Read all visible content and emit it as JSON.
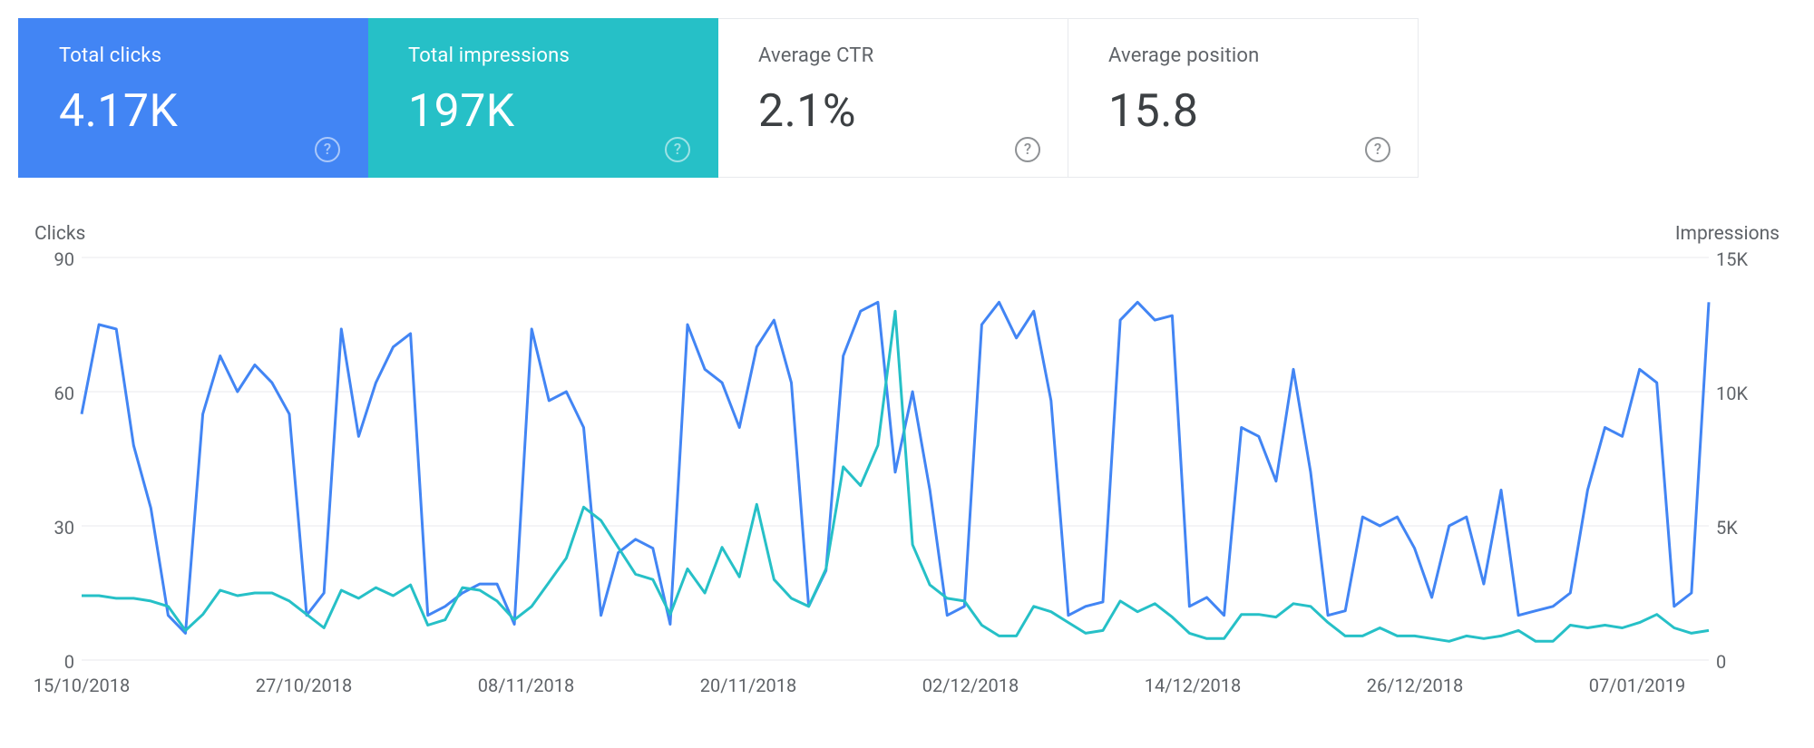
{
  "cards": [
    {
      "key": "clicks",
      "label": "Total clicks",
      "value": "4.17K",
      "active": true,
      "color": "#4285f4"
    },
    {
      "key": "impressions",
      "label": "Total impressions",
      "value": "197K",
      "active": true,
      "color": "#26c0c7"
    },
    {
      "key": "ctr",
      "label": "Average CTR",
      "value": "2.1%",
      "active": false,
      "color": "#ffffff"
    },
    {
      "key": "position",
      "label": "Average position",
      "value": "15.8",
      "active": false,
      "color": "#ffffff"
    }
  ],
  "help_glyph": "?",
  "left_axis_title": "Clicks",
  "right_axis_title": "Impressions",
  "left_ticks": [
    "90",
    "60",
    "30",
    "0"
  ],
  "right_ticks": [
    "15K",
    "10K",
    "5K",
    "0"
  ],
  "x_ticks": [
    "15/10/2018",
    "27/10/2018",
    "08/11/2018",
    "20/11/2018",
    "02/12/2018",
    "14/12/2018",
    "26/12/2018",
    "07/01/2019"
  ],
  "chart_data": {
    "type": "line",
    "title": "",
    "xlabel": "",
    "ylabel_left": "Clicks",
    "ylabel_right": "Impressions",
    "ylim_left": [
      0,
      90
    ],
    "ylim_right": [
      0,
      15000
    ],
    "x_tick_labels": [
      "15/10/2018",
      "27/10/2018",
      "08/11/2018",
      "20/11/2018",
      "02/12/2018",
      "14/12/2018",
      "26/12/2018",
      "07/01/2019"
    ],
    "series": [
      {
        "name": "Clicks",
        "axis": "left",
        "color": "#4285f4",
        "values": [
          55,
          75,
          74,
          48,
          34,
          10,
          6,
          55,
          68,
          60,
          66,
          62,
          55,
          10,
          15,
          74,
          50,
          62,
          70,
          73,
          10,
          12,
          15,
          17,
          17,
          8,
          74,
          58,
          60,
          52,
          10,
          24,
          27,
          25,
          8,
          75,
          65,
          62,
          52,
          70,
          76,
          62,
          12,
          20,
          68,
          78,
          80,
          42,
          60,
          38,
          10,
          12,
          75,
          80,
          72,
          78,
          58,
          10,
          12,
          13,
          76,
          80,
          76,
          77,
          12,
          14,
          10,
          52,
          50,
          40,
          65,
          42,
          10,
          11,
          32,
          30,
          32,
          25,
          14,
          30,
          32,
          17,
          38,
          10,
          11,
          12,
          15,
          38,
          52,
          50,
          65,
          62,
          12,
          15,
          80
        ]
      },
      {
        "name": "Impressions",
        "axis": "right",
        "color": "#26c0c7",
        "values": [
          2400,
          2400,
          2300,
          2300,
          2200,
          2000,
          1100,
          1700,
          2600,
          2400,
          2500,
          2500,
          2200,
          1700,
          1200,
          2600,
          2300,
          2700,
          2400,
          2800,
          1300,
          1500,
          2700,
          2600,
          2200,
          1500,
          2000,
          2900,
          3800,
          5700,
          5200,
          4200,
          3200,
          3000,
          1700,
          3400,
          2500,
          4200,
          3100,
          5800,
          3000,
          2300,
          2000,
          3400,
          7200,
          6500,
          8000,
          13000,
          4300,
          2800,
          2300,
          2200,
          1300,
          900,
          900,
          2000,
          1800,
          1400,
          1000,
          1100,
          2200,
          1800,
          2100,
          1600,
          1000,
          800,
          800,
          1700,
          1700,
          1600,
          2100,
          2000,
          1400,
          900,
          900,
          1200,
          900,
          900,
          800,
          700,
          900,
          800,
          900,
          1100,
          700,
          700,
          1300,
          1200,
          1300,
          1200,
          1400,
          1700,
          1200,
          1000,
          1100
        ]
      }
    ]
  }
}
